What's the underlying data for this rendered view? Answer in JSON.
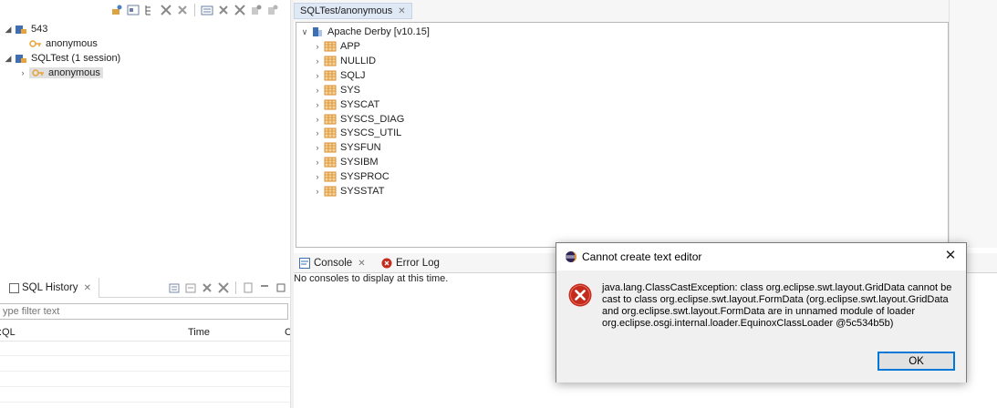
{
  "connections_view": {
    "nodes": [
      {
        "label": "543",
        "expanded": true
      },
      {
        "label": "anonymous"
      },
      {
        "label": "SQLTest (1 session)",
        "expanded": true
      },
      {
        "label": "anonymous",
        "selected": true
      }
    ]
  },
  "editor": {
    "tab_label": "SQLTest/anonymous",
    "root_label": "Apache Derby  [v10.15]",
    "schemas": [
      "APP",
      "NULLID",
      "SQLJ",
      "SYS",
      "SYSCAT",
      "SYSCS_DIAG",
      "SYSCS_UTIL",
      "SYSFUN",
      "SYSIBM",
      "SYSPROC",
      "SYSSTAT"
    ]
  },
  "history": {
    "tab_label": "SQL History",
    "filter_placeholder": "ype filter text",
    "columns": [
      ":QL",
      "Time",
      "C"
    ]
  },
  "console": {
    "tabs": [
      "Console",
      "Error Log"
    ],
    "message": "No consoles to display at this time."
  },
  "dialog": {
    "title": "Cannot create text editor",
    "message": "java.lang.ClassCastException: class org.eclipse.swt.layout.GridData cannot be cast to class org.eclipse.swt.layout.FormData (org.eclipse.swt.layout.GridData and org.eclipse.swt.layout.FormData are in unnamed module of loader org.eclipse.osgi.internal.loader.EquinoxClassLoader @5c534b5b)",
    "ok_label": "OK"
  },
  "colors": {
    "accent": "#0078d7",
    "error": "#c42b1c",
    "schema_icon": "#d98c2b",
    "session_icon": "#e8a33a"
  }
}
